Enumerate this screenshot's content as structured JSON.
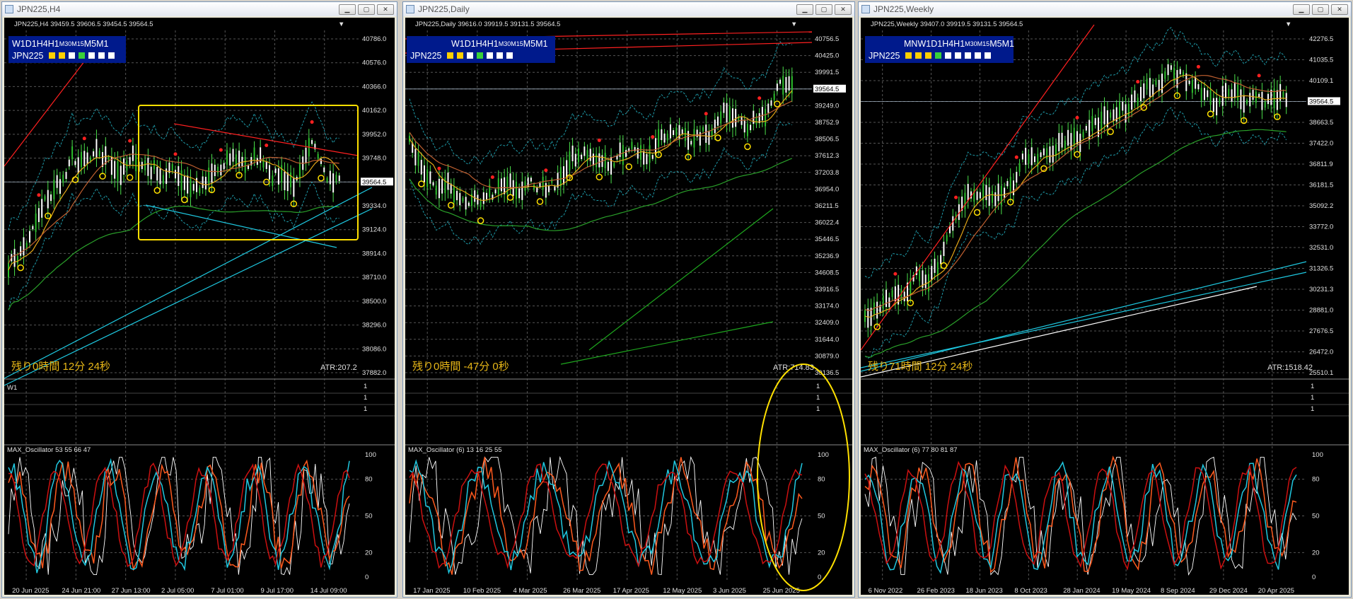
{
  "windows": [
    {
      "title": "JPN225,H4",
      "header": "JPN225,H4  39459.5 39606.5 39454.5 39564.5",
      "tf_labels": [
        "W1",
        "D1",
        "H4",
        "H1",
        "M30",
        "M15",
        "M5",
        "M1"
      ],
      "symbol": "JPN225",
      "squares": [
        "#ffd000",
        "#ffd000",
        "#ffffff",
        "#39d039",
        "#ffffff",
        "#ffffff",
        "#ffffff"
      ],
      "price_labels": [
        "40786.0",
        "40576.0",
        "40366.0",
        "40162.0",
        "39952.0",
        "39748.0",
        "39564.5",
        "39334.0",
        "39124.0",
        "38914.0",
        "38710.0",
        "38500.0",
        "38296.0",
        "38086.0",
        "37882.0"
      ],
      "current_price": "39564.5",
      "countdown": "残り0時間 12分 24秒",
      "atr": "ATR:207.2",
      "band_label": "W1",
      "osc_header": "MAX_Oscillator 53 55 66 47",
      "osc_levels": [
        "100",
        "80",
        "50",
        "20",
        "0"
      ],
      "dates": [
        "20 Jun 2025",
        "24 Jun 21:00",
        "27 Jun 13:00",
        "2 Jul 05:00",
        "7 Jul 01:00",
        "9 Jul 17:00",
        "14 Jul 09:00"
      ]
    },
    {
      "title": "JPN225,Daily",
      "header": "JPN225,Daily  39616.0 39919.5 39131.5 39564.5",
      "tf_labels": [
        "W1",
        "D1",
        "H4",
        "H1",
        "M30",
        "M15",
        "M5",
        "M1"
      ],
      "symbol": "JPN225",
      "squares": [
        "#ffd000",
        "#ffd000",
        "#ffffff",
        "#39d039",
        "#ffffff",
        "#ffffff",
        "#ffffff"
      ],
      "price_labels": [
        "40756.5",
        "40425.0",
        "39991.5",
        "39564.5",
        "39249.0",
        "38752.9",
        "38506.5",
        "37612.3",
        "37203.8",
        "36954.0",
        "36211.5",
        "36022.4",
        "35446.5",
        "35236.9",
        "34608.5",
        "33916.5",
        "33174.0",
        "32409.0",
        "31644.0",
        "30879.0",
        "30136.5"
      ],
      "current_price": "39564.5",
      "countdown": "残り0時間 -47分 0秒",
      "atr": "ATR:714.83",
      "osc_header": "MAX_Oscillator (6) 13 16 25 55",
      "osc_levels": [
        "100",
        "80",
        "50",
        "20",
        "0"
      ],
      "dates": [
        "17 Jan 2025",
        "10 Feb 2025",
        "4 Mar 2025",
        "26 Mar 2025",
        "17 Apr 2025",
        "12 May 2025",
        "3 Jun 2025",
        "25 Jun 2025"
      ]
    },
    {
      "title": "JPN225,Weekly",
      "header": "JPN225,Weekly  39407.0 39919.5 39131.5 39564.5",
      "tf_labels": [
        "MN",
        "W1",
        "D1",
        "H4",
        "H1",
        "M30",
        "M15",
        "M5",
        "M1"
      ],
      "symbol": "JPN225",
      "squares": [
        "#ffd000",
        "#ffd000",
        "#ffd000",
        "#39d039",
        "#ffffff",
        "#ffffff",
        "#ffffff",
        "#ffffff",
        "#ffffff"
      ],
      "price_labels": [
        "42276.5",
        "41035.5",
        "40109.1",
        "39564.5",
        "38663.5",
        "37422.0",
        "36811.9",
        "36181.5",
        "35092.2",
        "33772.0",
        "32531.0",
        "31326.5",
        "30231.3",
        "28881.0",
        "27676.5",
        "26472.0",
        "25510.1"
      ],
      "current_price": "39564.5",
      "countdown": "残り71時間 12分 24秒",
      "atr": "ATR:1518.42",
      "osc_header": "MAX_Oscillator (6) 77 80 81 87",
      "osc_levels": [
        "100",
        "80",
        "50",
        "20",
        "0"
      ],
      "dates": [
        "6 Nov 2022",
        "26 Feb 2023",
        "18 Jun 2023",
        "8 Oct 2023",
        "28 Jan 2024",
        "19 May 2024",
        "8 Sep 2024",
        "29 Dec 2024",
        "20 Apr 2025"
      ]
    }
  ]
}
